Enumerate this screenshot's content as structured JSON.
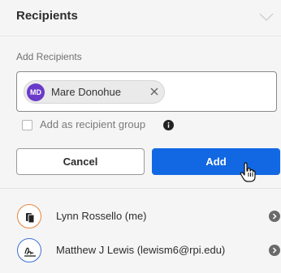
{
  "header": {
    "title": "Recipients"
  },
  "add_section": {
    "label": "Add Recipients"
  },
  "chip": {
    "initials": "MD",
    "name": "Mare Donohue"
  },
  "group_option": {
    "label": "Add as recipient group"
  },
  "actions": {
    "cancel_label": "Cancel",
    "add_label": "Add"
  },
  "recipients": [
    {
      "name": "Lynn Rossello (me)",
      "icon": "stamp-icon",
      "ring_color": "#e8833a"
    },
    {
      "name": "Matthew J Lewis (lewism6@rpi.edu)",
      "icon": "signature-icon",
      "ring_color": "#3a6fd8"
    }
  ],
  "colors": {
    "primary": "#1268e3",
    "chip_avatar": "#6a3bc9"
  }
}
